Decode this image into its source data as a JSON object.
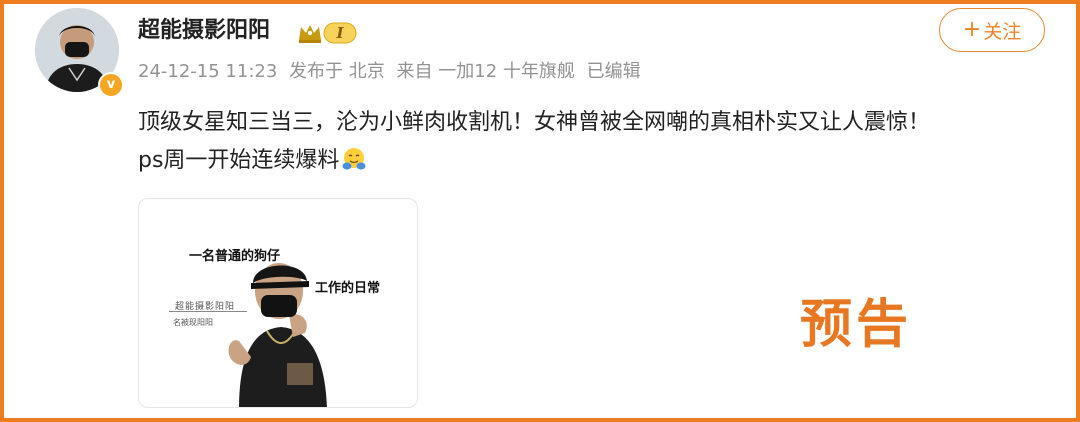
{
  "post": {
    "username": "超能摄影阳阳",
    "level_badge_text": "I",
    "meta": {
      "date": "24-12-15 11:23",
      "location": "发布于 北京",
      "source": "来自 一加12 十年旗舰",
      "edited": "已编辑"
    },
    "follow_label": "关注",
    "follow_plus": "+",
    "text_line1": "顶级女星知三当三，沦为小鲜肉收割机！女神曾被全网嘲的真相朴实又让人震惊！",
    "text_line2": "ps周一开始连续爆料",
    "text_emoji": "hug-emoji-icon"
  },
  "media": {
    "caption_top": "一名普通的狗仔",
    "caption_side": "工作的日常",
    "stamp_main": "超能摄影阳阳",
    "stamp_sub": "名被现阳阳"
  },
  "overlay": {
    "preview_label": "预告"
  },
  "colors": {
    "frame": "#f07c20",
    "accent": "#e8852a",
    "meta_gray": "#939393",
    "badge_gold": "#f5a623"
  }
}
